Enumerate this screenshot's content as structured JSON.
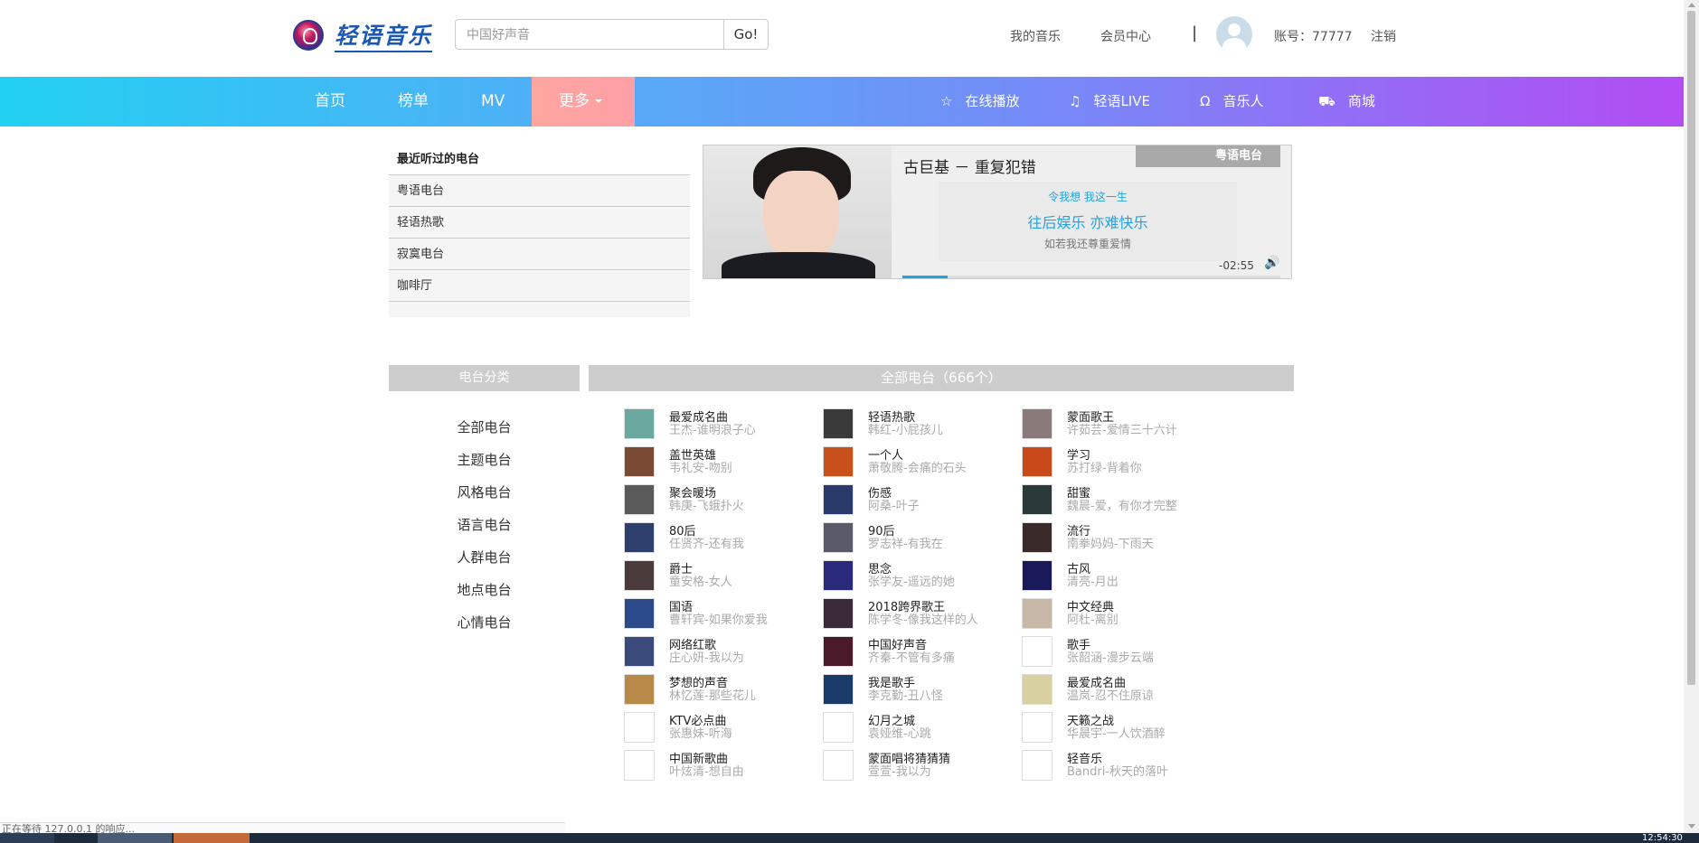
{
  "header": {
    "logo_text": "轻语音乐",
    "search_placeholder": "中国好声音",
    "search_button": "Go!",
    "my_music": "我的音乐",
    "member_center": "会员中心",
    "separator": "|",
    "account": "账号：77777",
    "logout": "注销"
  },
  "nav": {
    "items": [
      "首页",
      "榜单",
      "MV"
    ],
    "more": "更多",
    "right": [
      {
        "icon": "star-icon",
        "label": "在线播放"
      },
      {
        "icon": "music-note-icon",
        "label": "轻语LIVE"
      },
      {
        "icon": "headphones-icon",
        "label": "音乐人"
      },
      {
        "icon": "cart-icon",
        "label": "商城"
      }
    ]
  },
  "recent": {
    "title": "最近听过的电台",
    "items": [
      "粤语电台",
      "轻语热歌",
      "寂寞电台",
      "咖啡厅"
    ]
  },
  "player": {
    "song": "古巨基 － 重复犯错",
    "station": "粤语电台",
    "lyric_prev": "令我想  我这一生",
    "lyric_current": "往后娱乐  亦难快乐",
    "lyric_next": "如若我还尊重爱情",
    "time": "-02:55",
    "progress": 0.12
  },
  "categories": {
    "title": "电台分类",
    "items": [
      "全部电台",
      "主题电台",
      "风格电台",
      "语言电台",
      "人群电台",
      "地点电台",
      "心情电台"
    ]
  },
  "all_stations": {
    "title": "全部电台（666个）",
    "columns": [
      [
        {
          "name": "最爱成名曲",
          "sub": "王杰-谁明浪子心",
          "color": "#6aa8a0"
        },
        {
          "name": "盖世英雄",
          "sub": "韦礼安-吻别",
          "color": "#7a4a35"
        },
        {
          "name": "聚会暖场",
          "sub": "韩庚-飞蛾扑火",
          "color": "#5a5a5a"
        },
        {
          "name": "80后",
          "sub": "任贤齐-还有我",
          "color": "#2d3f6a"
        },
        {
          "name": "爵士",
          "sub": "童安格-女人",
          "color": "#4a3a3a"
        },
        {
          "name": "国语",
          "sub": "曹轩宾-如果你爱我",
          "color": "#2a4a8a"
        },
        {
          "name": "网络红歌",
          "sub": "庄心妍-我以为",
          "color": "#3a4a7a"
        },
        {
          "name": "梦想的声音",
          "sub": "林忆莲-那些花儿",
          "color": "#b88a4a"
        },
        {
          "name": "KTV必点曲",
          "sub": "张惠妹-听海",
          "color": "#ffffff"
        },
        {
          "name": "中国新歌曲",
          "sub": "叶炫清-想自由",
          "color": "#ffffff"
        }
      ],
      [
        {
          "name": "轻语热歌",
          "sub": "韩红-小屁孩儿",
          "color": "#3a3a3a"
        },
        {
          "name": "一个人",
          "sub": "萧敬腾-会痛的石头",
          "color": "#c8501a"
        },
        {
          "name": "伤感",
          "sub": "阿桑-叶子",
          "color": "#2a3a6a"
        },
        {
          "name": "90后",
          "sub": "罗志祥-有我在",
          "color": "#5a5a6a"
        },
        {
          "name": "思念",
          "sub": "张学友-遥远的她",
          "color": "#2a2a7a"
        },
        {
          "name": "2018跨界歌王",
          "sub": "陈学冬-像我这样的人",
          "color": "#3a2a3a"
        },
        {
          "name": "中国好声音",
          "sub": "齐秦-不管有多痛",
          "color": "#4a1a2a"
        },
        {
          "name": "我是歌手",
          "sub": "李克勤-丑八怪",
          "color": "#1a3a6a"
        },
        {
          "name": "幻月之城",
          "sub": "袁娅维-心跳",
          "color": "#ffffff"
        },
        {
          "name": "蒙面唱将猜猜猜",
          "sub": "萱萱-我以为",
          "color": "#ffffff"
        }
      ],
      [
        {
          "name": "蒙面歌王",
          "sub": "许茹芸-爱情三十六计",
          "color": "#8a7a7a"
        },
        {
          "name": "学习",
          "sub": "苏打绿-背着你",
          "color": "#c84a1a"
        },
        {
          "name": "甜蜜",
          "sub": "魏晨-爱，有你才完整",
          "color": "#2a3a3a"
        },
        {
          "name": "流行",
          "sub": "南拳妈妈-下雨天",
          "color": "#3a2a2a"
        },
        {
          "name": "古风",
          "sub": "清亮-月出",
          "color": "#1a1a5a"
        },
        {
          "name": "中文经典",
          "sub": "阿杜-离别",
          "color": "#c8b8a8"
        },
        {
          "name": "歌手",
          "sub": "张韶涵-漫步云端",
          "color": "#ffffff"
        },
        {
          "name": "最爱成名曲",
          "sub": "温岚-忍不住原谅",
          "color": "#d8d0a0"
        },
        {
          "name": "天籁之战",
          "sub": "华晨宇-一人饮酒醉",
          "color": "#ffffff"
        },
        {
          "name": "轻音乐",
          "sub": "Bandri-秋天的落叶",
          "color": "#ffffff"
        }
      ]
    ]
  },
  "status_bar": "正在等待 127.0.0.1 的响应...",
  "clock": "12:54:30"
}
